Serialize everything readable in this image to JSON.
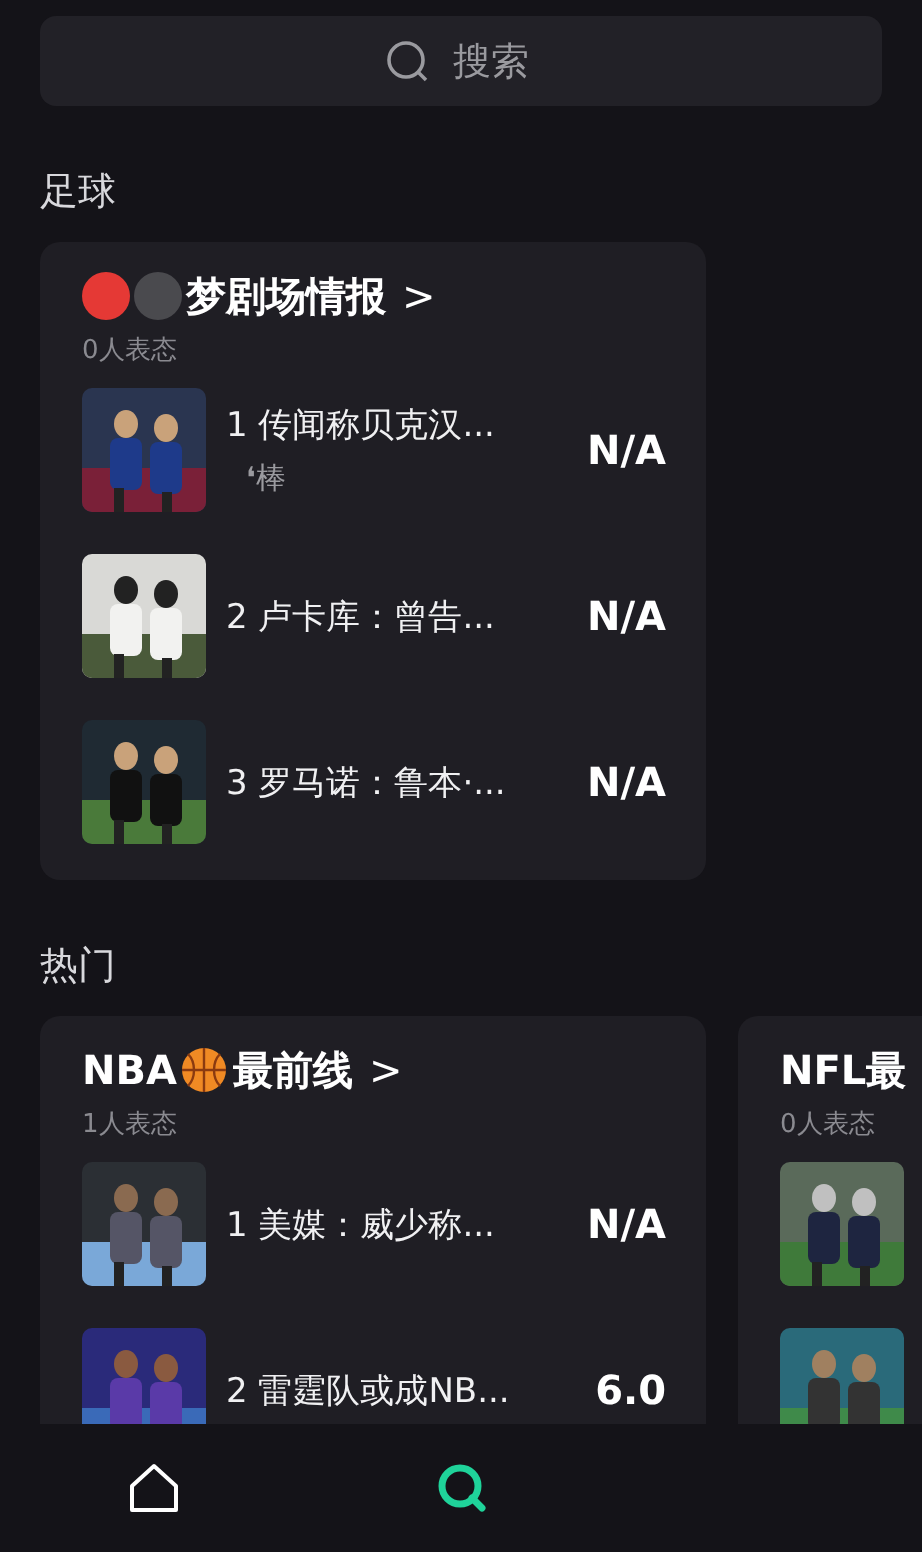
{
  "search": {
    "placeholder": "搜索"
  },
  "sections": [
    {
      "title": "足球",
      "cards": [
        {
          "title_parts": [
            {
              "kind": "red-ball"
            },
            {
              "kind": "dark-ball"
            },
            {
              "kind": "text",
              "text": "梦剧场情报"
            }
          ],
          "chevron": ">",
          "reactions": "0人表态",
          "rows": [
            {
              "thumb": {
                "kind": "picture"
              },
              "rank": "1",
              "headline": "传闻称贝克汉...",
              "subline": "❛棒",
              "score": "N/A"
            },
            {
              "thumb": {
                "kind": "picture"
              },
              "rank": "2",
              "headline": "卢卡库：曾告...",
              "score": "N/A"
            },
            {
              "thumb": {
                "kind": "picture"
              },
              "rank": "3",
              "headline": "罗马诺：鲁本·...",
              "score": "N/A"
            }
          ]
        }
      ]
    },
    {
      "title": "热门",
      "cards": [
        {
          "title_parts": [
            {
              "kind": "text",
              "text": "NBA"
            },
            {
              "kind": "basketball"
            },
            {
              "kind": "text",
              "text": "最前线"
            }
          ],
          "chevron": ">",
          "reactions": "1人表态",
          "rows": [
            {
              "thumb": {
                "kind": "picture"
              },
              "rank": "1",
              "headline": "美媒：威少称...",
              "score": "N/A"
            },
            {
              "thumb": {
                "kind": "picture"
              },
              "rank": "2",
              "headline": "雷霆队或成NB...",
              "score": "6.0"
            }
          ]
        },
        {
          "title_parts": [
            {
              "kind": "text",
              "text": "NFL最"
            }
          ],
          "reactions": "0人表态",
          "rows": [
            {
              "thumb": {
                "kind": "picture"
              }
            },
            {
              "thumb": {
                "kind": "picture"
              }
            }
          ]
        }
      ]
    }
  ],
  "nav": [
    {
      "kind": "home",
      "selected": false
    },
    {
      "kind": "search",
      "selected": true
    }
  ]
}
